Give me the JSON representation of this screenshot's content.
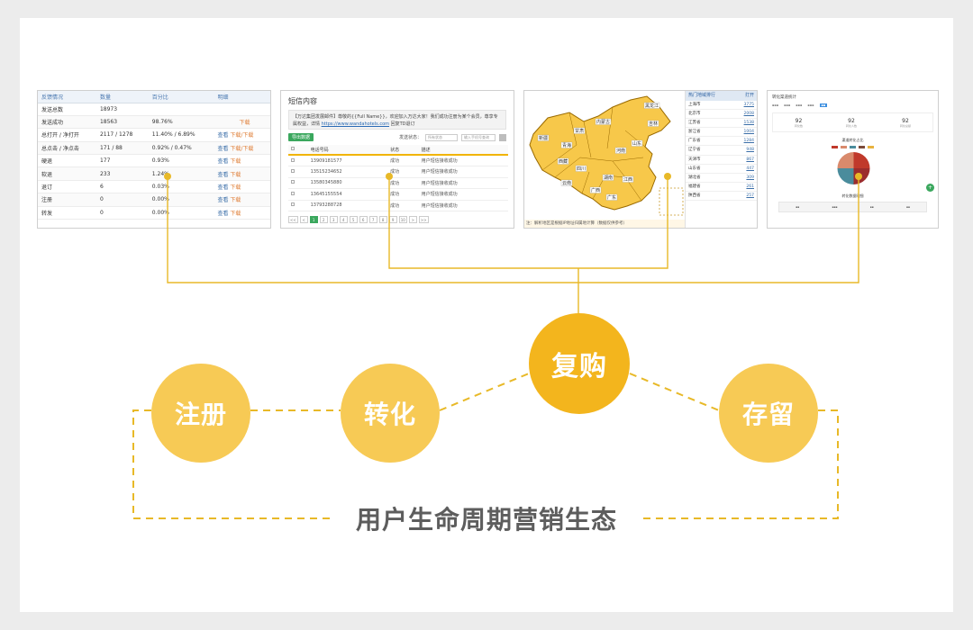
{
  "shot1": {
    "headers": [
      "反馈情况",
      "数量",
      "百分比",
      "明细"
    ],
    "rows": [
      {
        "label": "发送总数",
        "count": "18973",
        "pct": "",
        "view": "",
        "dl": ""
      },
      {
        "label": "发送成功",
        "count": "18563",
        "pct": "98.76%",
        "view": "",
        "dl": "下载"
      },
      {
        "label": "总打开 / 净打开",
        "count": "2117 / 1278",
        "pct": "11.40% / 6.89%",
        "view": "查看",
        "dl": "下载/下载"
      },
      {
        "label": "总点击 / 净点击",
        "count": "171 / 88",
        "pct": "0.92% / 0.47%",
        "view": "查看",
        "dl": "下载/下载"
      },
      {
        "label": "硬退",
        "count": "177",
        "pct": "0.93%",
        "view": "查看",
        "dl": "下载"
      },
      {
        "label": "软退",
        "count": "233",
        "pct": "1.24%",
        "view": "查看",
        "dl": "下载"
      },
      {
        "label": "退订",
        "count": "6",
        "pct": "0.03%",
        "view": "查看",
        "dl": "下载"
      },
      {
        "label": "注册",
        "count": "0",
        "pct": "0.00%",
        "view": "查看",
        "dl": "下载"
      },
      {
        "label": "转发",
        "count": "0",
        "pct": "0.00%",
        "view": "查看",
        "dl": "下载"
      }
    ]
  },
  "shot2": {
    "title": "短信内容",
    "note_text": "【万达集团发展邮件】尊敬的{{Full Name}}，欢迎加入万达大家！我们成功注册为某个会员，尊享专属权益，详情",
    "note_link": "https://www.wandahotels.com",
    "note_tail": "回复TD退订",
    "export_btn": "导出数据",
    "status_label": "发送状态：",
    "status_select": "所有状态",
    "phone_placeholder": "输入手机号查询",
    "headers": [
      "电话号码",
      "状态",
      "描述"
    ],
    "rows": [
      {
        "phone": "13909181577",
        "status": "成功",
        "desc": "用户短信接收成功"
      },
      {
        "phone": "13515234652",
        "status": "成功",
        "desc": "用户短信接收成功"
      },
      {
        "phone": "13580345880",
        "status": "成功",
        "desc": "用户短信接收成功"
      },
      {
        "phone": "13645155554",
        "status": "成功",
        "desc": "用户短信接收成功"
      },
      {
        "phone": "13793288728",
        "status": "成功",
        "desc": "用户短信接收成功"
      }
    ],
    "pages": [
      "<<",
      "<",
      "1",
      "2",
      "3",
      "4",
      "5",
      "6",
      "7",
      "8",
      "9",
      "10",
      ">",
      ">>"
    ]
  },
  "shot3": {
    "rank_header": [
      "热门地域排行",
      "打开"
    ],
    "ranks": [
      {
        "region": "上海市",
        "value": "3775"
      },
      {
        "region": "北京市",
        "value": "2008"
      },
      {
        "region": "江苏省",
        "value": "1538"
      },
      {
        "region": "浙江省",
        "value": "1004"
      },
      {
        "region": "广东省",
        "value": "1284"
      },
      {
        "region": "辽宁省",
        "value": "948"
      },
      {
        "region": "天津市",
        "value": "867"
      },
      {
        "region": "山东省",
        "value": "447"
      },
      {
        "region": "湖北省",
        "value": "309"
      },
      {
        "region": "福建省",
        "value": "261"
      },
      {
        "region": "陕西省",
        "value": "257"
      }
    ],
    "footer": "注：解析地区是根据IP地址归属地计算（数据仅供参考）",
    "map_labels": [
      "新疆",
      "西藏",
      "青海",
      "甘肃",
      "内蒙古",
      "黑龙江",
      "吉林",
      "四川",
      "云南",
      "广西",
      "广东",
      "湖南",
      "江西",
      "河南",
      "山东"
    ]
  },
  "shot4": {
    "title": "转化渠道统计",
    "stats": [
      {
        "value": "92",
        "label": "转化数"
      },
      {
        "value": "92",
        "label": "转化人数"
      },
      {
        "value": "92",
        "label": "转化总额"
      }
    ],
    "chart_title": "渠道转化占比",
    "table_title": "转化数据明细",
    "plus": "+"
  },
  "diagram": {
    "register": "注册",
    "convert": "转化",
    "repurchase": "复购",
    "retain": "存留",
    "ecosystem": "用户生命周期营销生态"
  },
  "colors": {
    "accent_dark": "#f3b51d",
    "accent_light": "#f7ca55",
    "line": "#e8b928",
    "title_text": "#5d5d5d"
  }
}
